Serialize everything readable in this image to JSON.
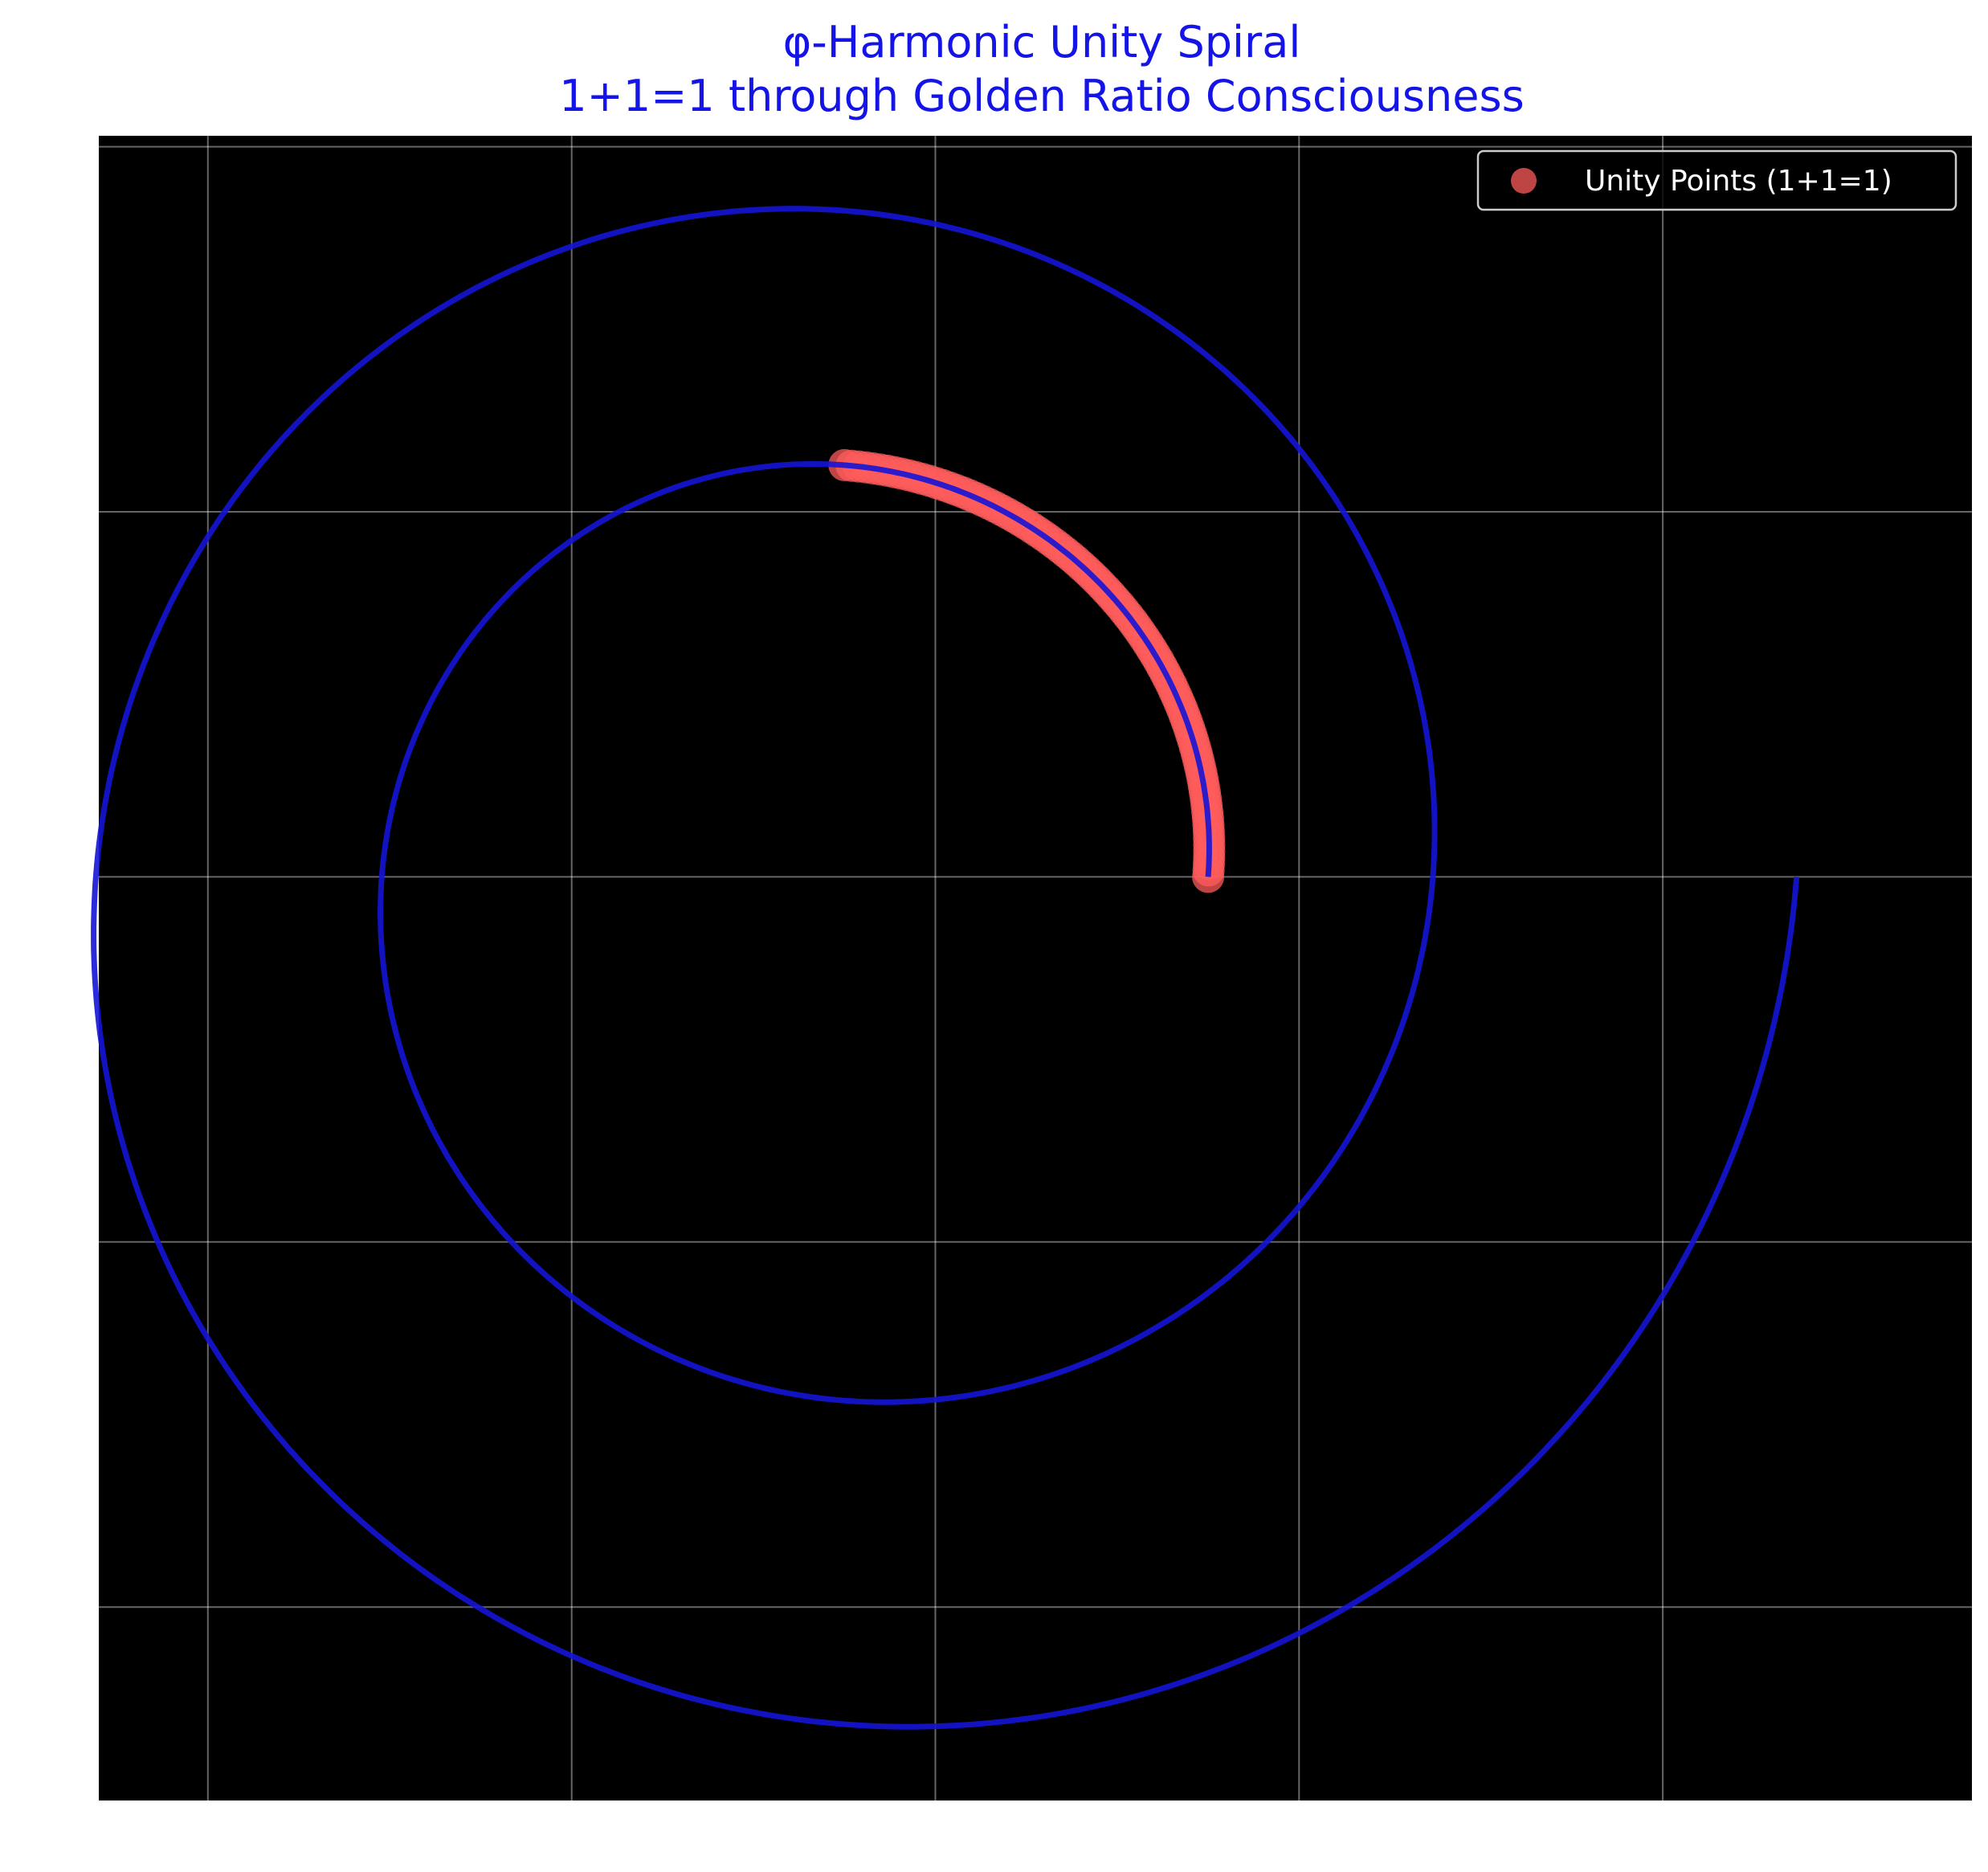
{
  "chart_data": {
    "type": "line",
    "title": "φ-Harmonic Unity Spiral",
    "subtitle": "1+1=1 through Golden Ratio Consciousness",
    "xlabel": "",
    "ylabel": "",
    "xlim": [
      -2.05,
      3.1
    ],
    "ylim": [
      -2.53,
      2.03
    ],
    "x_ticks": [
      -1.75,
      -0.75,
      0.25,
      1.25,
      2.25
    ],
    "y_ticks": [
      2.0,
      1.0,
      0.0,
      -1.0,
      -2.0
    ],
    "grid": true,
    "background": "#000000",
    "legend": {
      "position": "top-right",
      "entries": [
        {
          "label": "Unity Points (1+1=1)",
          "marker": "circle",
          "color": "#ff5c5c"
        }
      ]
    },
    "series": [
      {
        "kind": "line",
        "color": "#1414d6",
        "spiral": {
          "r0": 1.0,
          "growth_per_turn": 1.618,
          "theta_start_deg": 0,
          "theta_end_deg": 720
        }
      },
      {
        "kind": "scatter",
        "name": "Unity Points (1+1=1)",
        "color": "#ff5c5c",
        "spiral": {
          "r0": 1.0,
          "growth_per_turn": 1.618,
          "theta_start_deg": 0,
          "theta_end_deg": 90
        },
        "point_count": 90
      }
    ]
  }
}
